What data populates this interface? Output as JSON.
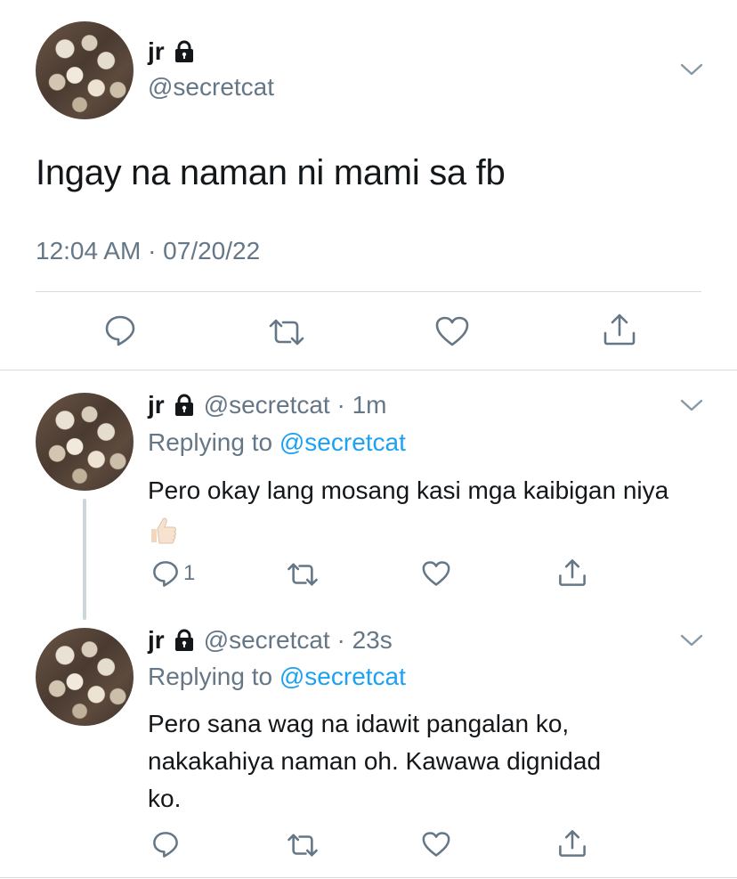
{
  "main_tweet": {
    "name": "jr",
    "handle": "@secretcat",
    "text": "Ingay na naman ni mami sa fb",
    "timestamp": "12:04 AM · 07/20/22"
  },
  "replies": [
    {
      "name": "jr",
      "handle_time": "@secretcat · 1m",
      "replying_prefix": "Replying to",
      "replying_to": "@secretcat",
      "text": "Pero okay lang mosang kasi mga kaibigan niya",
      "emoji": "thumbs-up",
      "reply_count": "1"
    },
    {
      "name": "jr",
      "handle_time": "@secretcat · 23s",
      "replying_prefix": "Replying to",
      "replying_to": "@secretcat",
      "text_line1": "Pero sana wag na idawit pangalan ko,",
      "text_line2": "nakakahiya naman oh. Kawawa dignidad",
      "text_line3": "ko."
    }
  ],
  "icons": [
    "lock-icon",
    "chevron-down-icon",
    "reply-icon",
    "retweet-icon",
    "like-icon",
    "share-icon"
  ],
  "colors": {
    "text": "#14171a",
    "secondary": "#657786",
    "link": "#1da1f2",
    "divider": "#d6dce1"
  }
}
